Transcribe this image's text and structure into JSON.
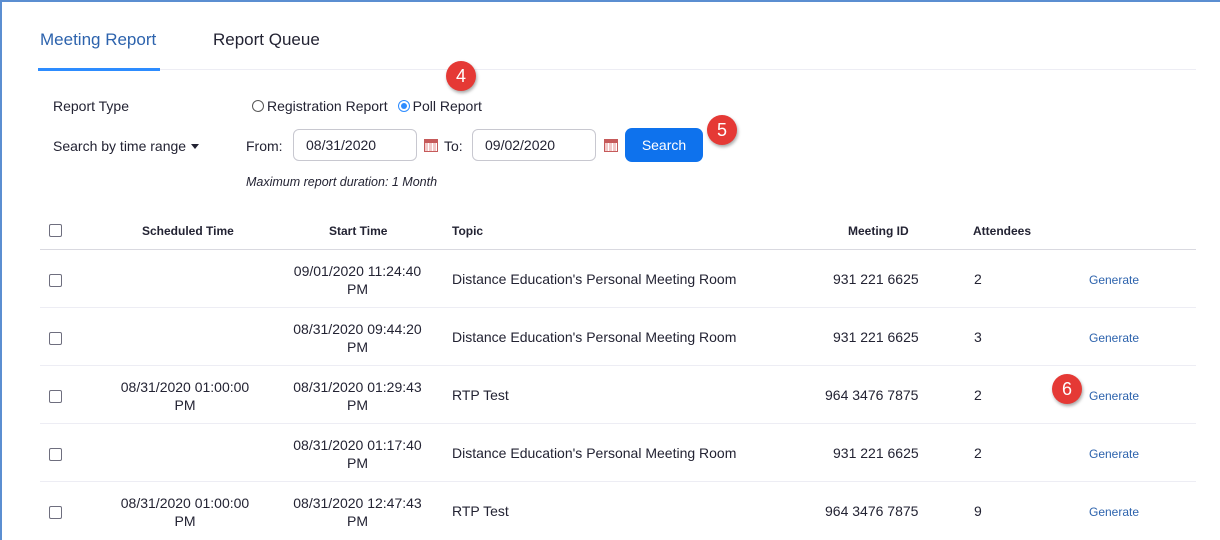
{
  "tabs": [
    {
      "label": "Meeting Report",
      "active": true
    },
    {
      "label": "Report Queue",
      "active": false
    }
  ],
  "filters": {
    "report_type_label": "Report Type",
    "report_types": [
      {
        "label": "Registration Report",
        "selected": false
      },
      {
        "label": "Poll Report",
        "selected": true
      }
    ],
    "search_by_label": "Search by time range",
    "from_label": "From:",
    "from_value": "08/31/2020",
    "to_label": "To:",
    "to_value": "09/02/2020",
    "search_button": "Search",
    "note": "Maximum report duration: 1 Month"
  },
  "callouts": [
    "4",
    "5",
    "6"
  ],
  "table": {
    "headers": [
      "Scheduled Time",
      "Start Time",
      "Topic",
      "Meeting ID",
      "Attendees"
    ],
    "rows": [
      {
        "scheduled": [
          "",
          ""
        ],
        "start": [
          "09/01/2020 11:24:40",
          "PM"
        ],
        "topic": "Distance Education's Personal Meeting Room",
        "meeting_id": "931 221 6625",
        "attendees": "2",
        "action": "Generate"
      },
      {
        "scheduled": [
          "",
          ""
        ],
        "start": [
          "08/31/2020 09:44:20",
          "PM"
        ],
        "topic": "Distance Education's Personal Meeting Room",
        "meeting_id": "931 221 6625",
        "attendees": "3",
        "action": "Generate"
      },
      {
        "scheduled": [
          "08/31/2020 01:00:00",
          "PM"
        ],
        "start": [
          "08/31/2020 01:29:43",
          "PM"
        ],
        "topic": "RTP Test",
        "meeting_id": "964 3476 7875",
        "attendees": "2",
        "action": "Generate"
      },
      {
        "scheduled": [
          "",
          ""
        ],
        "start": [
          "08/31/2020 01:17:40",
          "PM"
        ],
        "topic": "Distance Education's Personal Meeting Room",
        "meeting_id": "931 221 6625",
        "attendees": "2",
        "action": "Generate"
      },
      {
        "scheduled": [
          "08/31/2020 01:00:00",
          "PM"
        ],
        "start": [
          "08/31/2020 12:47:43",
          "PM"
        ],
        "topic": "RTP Test",
        "meeting_id": "964 3476 7875",
        "attendees": "9",
        "action": "Generate"
      }
    ]
  },
  "colors": {
    "accent": "#0e72ed",
    "link": "#2d63ad",
    "badge": "#e53935"
  }
}
